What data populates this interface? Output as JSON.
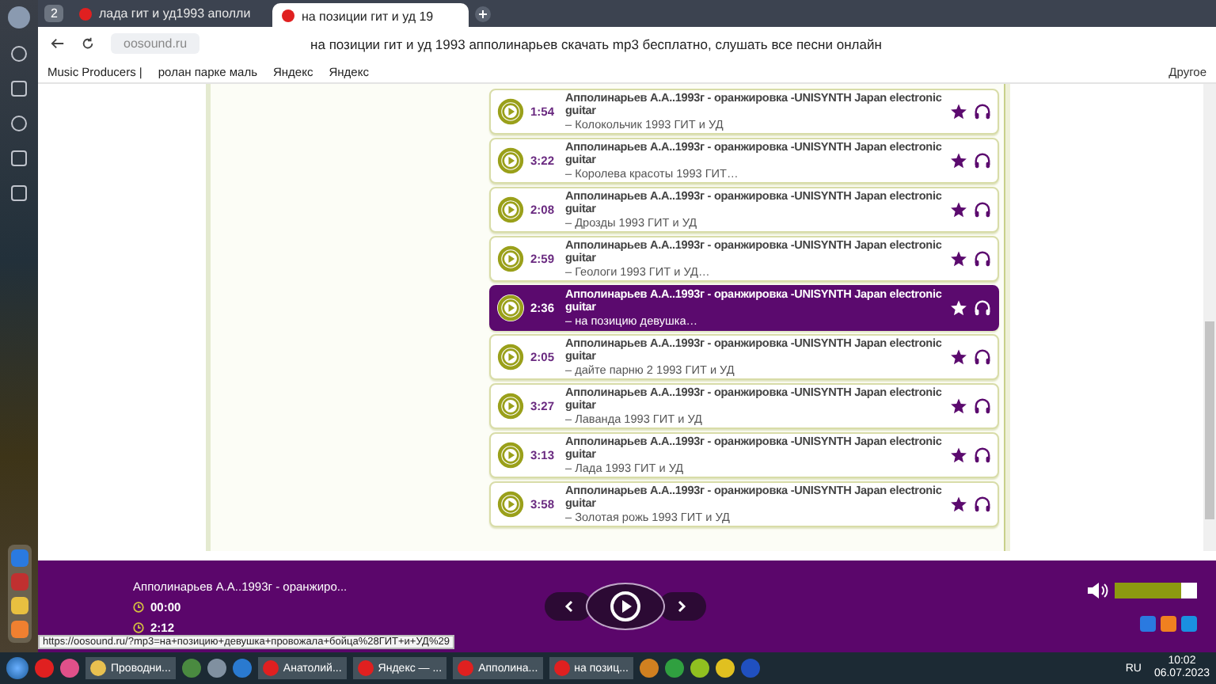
{
  "browser": {
    "tab_count": "2",
    "tabs": [
      {
        "label": "лада гит и уд1993 аполли",
        "selected": false
      },
      {
        "label": "на позиции гит и уд 19",
        "selected": true
      }
    ],
    "address": {
      "domain": "oosound.ru",
      "page_title": "на позиции гит и уд 1993 апполинарьев скачать mp3 бесплатно, слушать все песни онлайн"
    },
    "bookmarks": [
      "Music Producers |",
      "ролан парке маль",
      "Яндекс",
      "Яндекс"
    ],
    "bookmarks_other": "Другое"
  },
  "tracks": [
    {
      "duration": "1:54",
      "title": "Апполинарьев А.А..1993г - оранжировка -UNISYNTH Japan electronic guitar",
      "subtitle": "– Колокольчик 1993 ГИТ и УД",
      "selected": false
    },
    {
      "duration": "3:22",
      "title": "Апполинарьев А.А..1993г - оранжировка -UNISYNTH Japan electronic guitar",
      "subtitle": "– Королева красоты 1993 ГИТ…",
      "selected": false
    },
    {
      "duration": "2:08",
      "title": "Апполинарьев А.А..1993г - оранжировка -UNISYNTH Japan electronic guitar",
      "subtitle": "– Дрозды 1993 ГИТ и УД",
      "selected": false
    },
    {
      "duration": "2:59",
      "title": "Апполинарьев А.А..1993г - оранжировка -UNISYNTH Japan electronic guitar",
      "subtitle": "– Геологи 1993 ГИТ и УД…",
      "selected": false
    },
    {
      "duration": "2:36",
      "title": "Апполинарьев А.А..1993г - оранжировка -UNISYNTH Japan electronic guitar",
      "subtitle": "– на позицию девушка…",
      "selected": true
    },
    {
      "duration": "2:05",
      "title": "Апполинарьев А.А..1993г - оранжировка -UNISYNTH Japan electronic guitar",
      "subtitle": "– дайте парню 2 1993 ГИТ и УД",
      "selected": false
    },
    {
      "duration": "3:27",
      "title": "Апполинарьев А.А..1993г - оранжировка -UNISYNTH Japan electronic guitar",
      "subtitle": "– Лаванда 1993 ГИТ и УД",
      "selected": false
    },
    {
      "duration": "3:13",
      "title": "Апполинарьев А.А..1993г - оранжировка -UNISYNTH Japan electronic guitar",
      "subtitle": "– Лада 1993 ГИТ и УД",
      "selected": false
    },
    {
      "duration": "3:58",
      "title": "Апполинарьев А.А..1993г - оранжировка -UNISYNTH Japan electronic guitar",
      "subtitle": "– Золотая рожь 1993 ГИТ и УД",
      "selected": false
    }
  ],
  "player": {
    "title": "Апполинарьев А.А..1993г - оранжиро...",
    "elapsed": "00:00",
    "total": "2:12",
    "volume": {
      "level": 0.8
    }
  },
  "status_url": "https://oosound.ru/?mp3=на+позицию+девушка+провожала+бойца%28ГИТ+и+УД%29",
  "taskbar": {
    "items": [
      {
        "kind": "app",
        "color": "#e02020"
      },
      {
        "kind": "app",
        "color": "#e0508a"
      },
      {
        "kind": "window",
        "label": "Проводни...",
        "color": "#e8c050"
      },
      {
        "kind": "app",
        "color": "#4a8a40"
      },
      {
        "kind": "app",
        "color": "#8090a0"
      },
      {
        "kind": "app",
        "color": "#2a7ad0"
      },
      {
        "kind": "window",
        "label": "Анатолий...",
        "color": "#e02020"
      },
      {
        "kind": "window",
        "label": "Яндекс — ...",
        "color": "#e02020"
      },
      {
        "kind": "window",
        "label": "Апполина...",
        "color": "#e02020"
      },
      {
        "kind": "window",
        "label": "на позиц...",
        "color": "#e02020"
      },
      {
        "kind": "app",
        "color": "#d08020"
      },
      {
        "kind": "app",
        "color": "#30a040"
      },
      {
        "kind": "app",
        "color": "#90c020"
      },
      {
        "kind": "app",
        "color": "#e0c020"
      },
      {
        "kind": "app",
        "color": "#2050c0"
      }
    ],
    "language": "RU",
    "time": "10:02",
    "date": "06.07.2023"
  }
}
